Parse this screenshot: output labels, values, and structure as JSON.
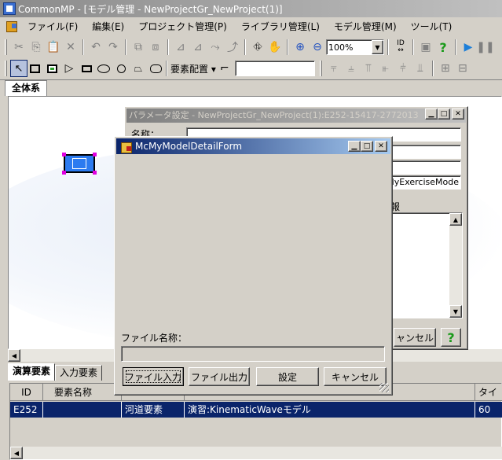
{
  "window": {
    "title": "CommonMP - [モデル管理 - NewProjectGr_NewProject(1)]"
  },
  "menu": {
    "items": [
      "ファイル(F)",
      "編集(E)",
      "プロジェクト管理(P)",
      "ライブラリ管理(L)",
      "モデル管理(M)",
      "ツール(T)"
    ]
  },
  "toolbar1": {
    "zoom_value": "100%",
    "id_label": "ID"
  },
  "toolbar2": {
    "layout_label": "要素配置",
    "layout_arrow": "▾"
  },
  "canvas": {
    "tab_label": "全体系"
  },
  "bottom_tabs": [
    "演算要素",
    "入力要素"
  ],
  "grid": {
    "headers": [
      "ID",
      "要素名称",
      "",
      "",
      "タイム"
    ],
    "row": {
      "id": "E252",
      "name": "",
      "type": "河道要素",
      "model": "演習:KinematicWaveモデル",
      "time": "60"
    }
  },
  "param_window": {
    "title": "パラメータ設定 - NewProjectGr_NewProject(1):E252-15417-2772013",
    "name_label": "名称：",
    "model_text": "@MyExerciseMode",
    "info_label": "情報",
    "cancel_label": "ャンセル",
    "help_label": "?"
  },
  "detail_form": {
    "title": "McMyModelDetailForm",
    "file_name_label": "ファイル名称：",
    "file_name_value": "",
    "buttons": {
      "file_input": "ファイル入力",
      "file_output": "ファイル出力",
      "settings": "設定",
      "cancel": "キャンセル"
    }
  },
  "colors": {
    "active_title": "#0a246a",
    "selection": "#0a246a",
    "node_fill": "#2c7bf0",
    "node_handle": "#e000e0",
    "play": "#1e7fd8",
    "help": "#1a9a1a"
  }
}
